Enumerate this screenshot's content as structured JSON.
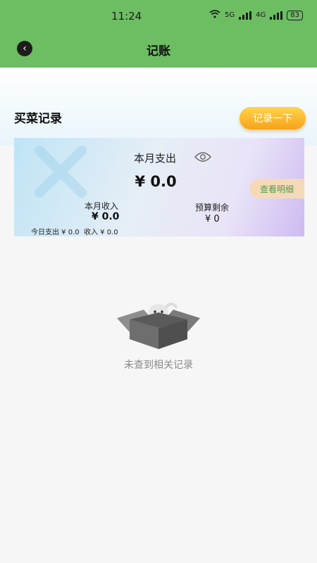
{
  "status_bar": {
    "time": "11:24",
    "network_5g": "5G",
    "network_4g": "4G",
    "battery": "83"
  },
  "nav": {
    "title": "记账",
    "back_icon": "chevron-left-icon"
  },
  "section": {
    "title": "买菜记录",
    "record_button": "记录一下"
  },
  "summary_card": {
    "expense_label": "本月支出",
    "expense_value": "¥ 0.0",
    "details_button": "查看明细",
    "income_label": "本月收入",
    "income_value": "¥ 0.0",
    "budget_label": "预算剩余",
    "budget_value": "¥  0",
    "today_line": "今日支出 ¥ 0.0  收入 ¥ 0.0"
  },
  "empty_state": {
    "text": "未查到相关记录",
    "icon": "empty-box-icon"
  },
  "colors": {
    "header_green": "#6dbd63",
    "button_orange": "#f6a21a",
    "details_text_green": "#4f9d4f"
  }
}
